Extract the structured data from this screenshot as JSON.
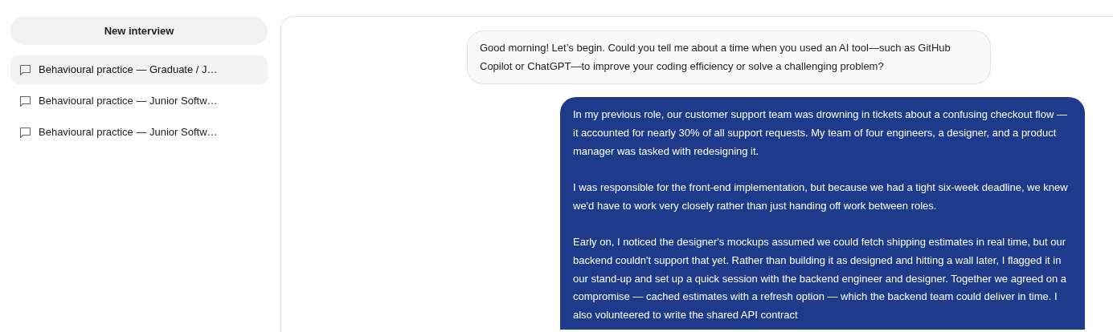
{
  "sidebar": {
    "new_button": "New interview",
    "items": [
      {
        "title": "Behavioural practice — Graduate / J…",
        "selected": true
      },
      {
        "title": "Behavioural practice — Junior Softw…",
        "selected": false
      },
      {
        "title": "Behavioural practice — Junior Softw…",
        "selected": false
      }
    ]
  },
  "messages": [
    {
      "kind": "assistant",
      "paragraphs": [
        "Good morning! Let’s begin. Could you tell me about a time when you used an AI tool—such as GitHub Copilot or ChatGPT—to improve your coding efficiency or solve a challenging problem?"
      ]
    },
    {
      "kind": "user",
      "paragraphs": [
        "In my previous role, our customer support team was drowning in tickets about a confusing checkout flow — it accounted for nearly 30% of all support requests. My team of four engineers, a designer, and a product manager was tasked with redesigning it.",
        "I was responsible for the front-end implementation, but because we had a tight six-week deadline, we knew we'd have to work very closely rather than just handing off work between roles.",
        "Early on, I noticed the designer's mockups assumed we could fetch shipping estimates in real time, but our backend couldn't support that yet. Rather than building it as designed and hitting a wall later, I flagged it in our stand-up and set up a quick session with the backend engineer and designer. Together we agreed on a compromise — cached estimates with a refresh option — which the backend team could deliver in time. I also volunteered to write the shared API contract"
      ]
    }
  ]
}
